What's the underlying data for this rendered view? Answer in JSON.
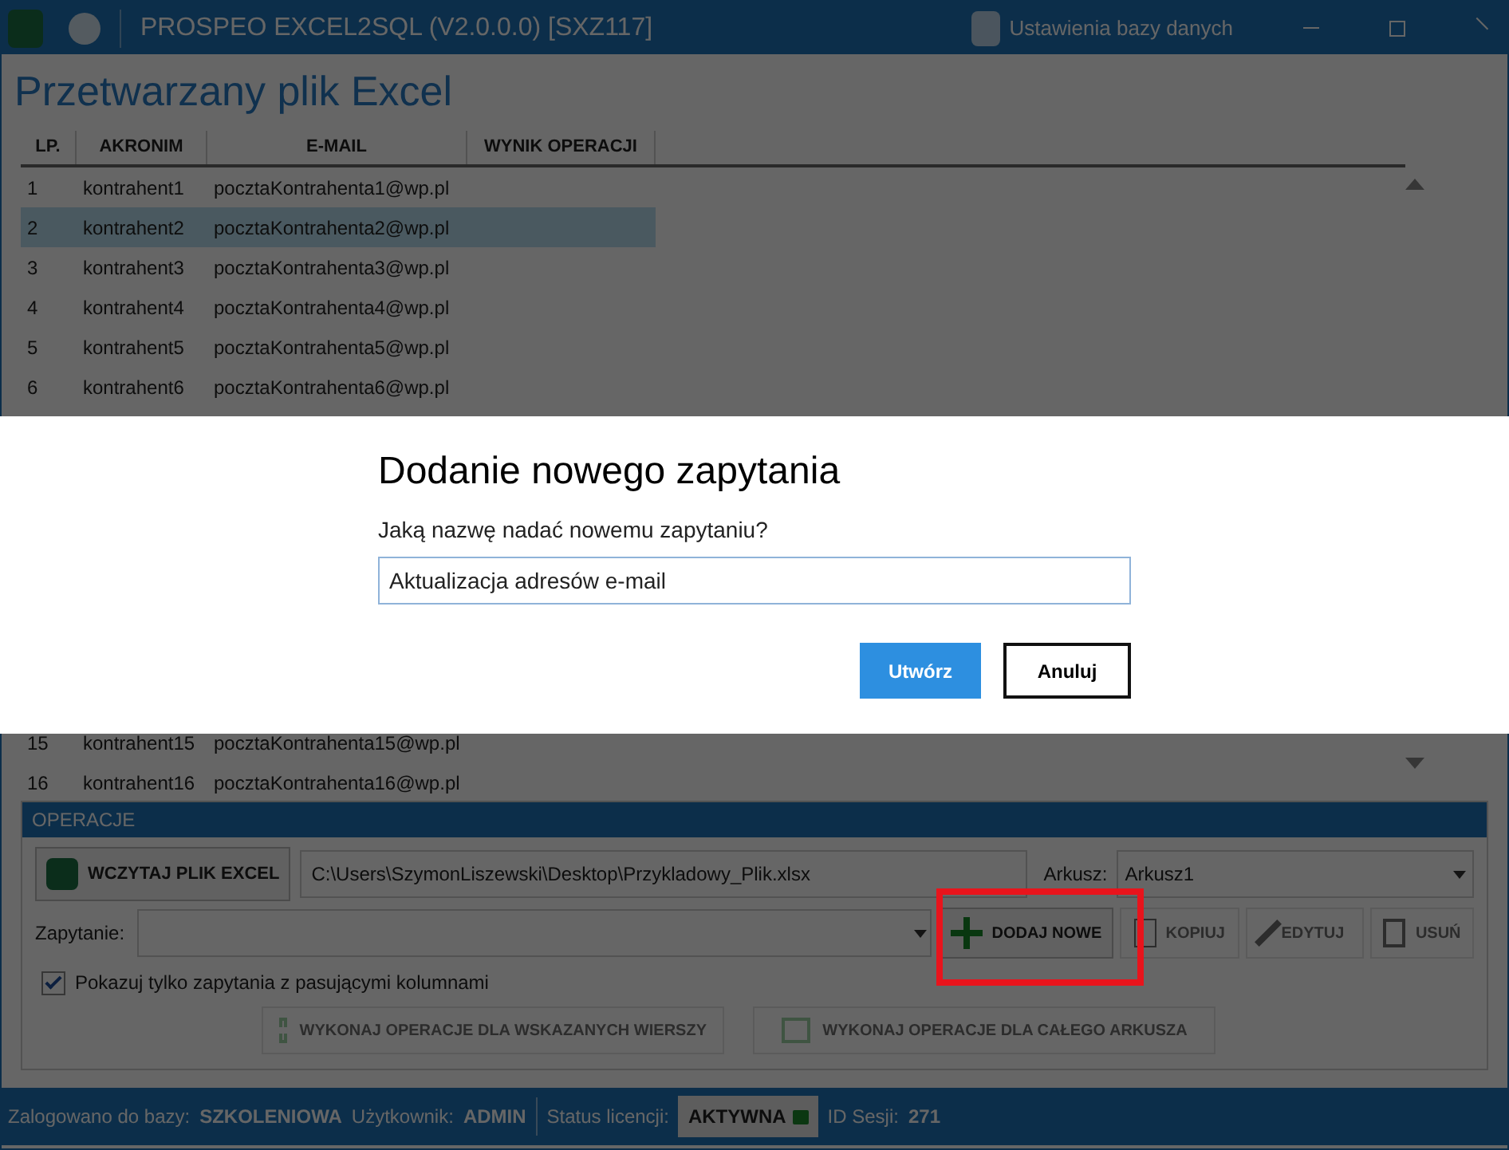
{
  "window": {
    "title": "PROSPEO EXCEL2SQL (V2.0.0.0) [SXZ117]",
    "db_settings": "Ustawienia bazy danych"
  },
  "heading": "Przetwarzany plik Excel",
  "table": {
    "columns": [
      "LP.",
      "AKRONIM",
      "E-MAIL",
      "WYNIK OPERACJI"
    ],
    "rows": [
      {
        "cells": [
          "1",
          "kontrahent1",
          "pocztaKontrahenta1@wp.pl",
          ""
        ],
        "selected": false
      },
      {
        "cells": [
          "2",
          "kontrahent2",
          "pocztaKontrahenta2@wp.pl",
          ""
        ],
        "selected": true
      },
      {
        "cells": [
          "3",
          "kontrahent3",
          "pocztaKontrahenta3@wp.pl",
          ""
        ],
        "selected": false
      },
      {
        "cells": [
          "4",
          "kontrahent4",
          "pocztaKontrahenta4@wp.pl",
          ""
        ],
        "selected": false
      },
      {
        "cells": [
          "5",
          "kontrahent5",
          "pocztaKontrahenta5@wp.pl",
          ""
        ],
        "selected": false
      },
      {
        "cells": [
          "6",
          "kontrahent6",
          "pocztaKontrahenta6@wp.pl",
          ""
        ],
        "selected": false
      }
    ],
    "rows_below_dialog": [
      {
        "cells": [
          "15",
          "kontrahent15",
          "pocztaKontrahenta15@wp.pl",
          ""
        ],
        "selected": false
      },
      {
        "cells": [
          "16",
          "kontrahent16",
          "pocztaKontrahenta16@wp.pl",
          ""
        ],
        "selected": false
      }
    ]
  },
  "operations": {
    "header": "OPERACJE",
    "load_button": "WCZYTAJ PLIK EXCEL",
    "file_path": "C:\\Users\\SzymonLiszewski\\Desktop\\Przykladowy_Plik.xlsx",
    "sheet_label": "Arkusz:",
    "sheet_value": "Arkusz1",
    "query_label": "Zapytanie:",
    "query_buttons": [
      {
        "label": "DODAJ NOWE",
        "kind": "add",
        "disabled": false
      },
      {
        "label": "KOPIUJ",
        "kind": "copy",
        "disabled": true
      },
      {
        "label": "EDYTUJ",
        "kind": "edit",
        "disabled": true
      },
      {
        "label": "USUŃ",
        "kind": "delete",
        "disabled": true
      }
    ],
    "filter_checkbox": {
      "label": "Pokazuj tylko zapytania z pasującymi kolumnami",
      "checked": true
    },
    "run_buttons": [
      {
        "label": "WYKONAJ OPERACJE DLA WSKAZANYCH WIERSZY",
        "kind": "rows",
        "disabled": true
      },
      {
        "label": "WYKONAJ OPERACJE DLA CAŁEGO ARKUSZA",
        "kind": "sheet",
        "disabled": true
      }
    ]
  },
  "status_bar": {
    "db_label": "Zalogowano do bazy:",
    "db_value": "SZKOLENIOWA",
    "user_label": "Użytkownik:",
    "user_value": "ADMIN",
    "license_label": "Status licencji:",
    "license_value": "AKTYWNA",
    "session_label": "ID Sesji:",
    "session_value": "271"
  },
  "dialog": {
    "title": "Dodanie nowego zapytania",
    "prompt": "Jaką nazwę nadać nowemu zapytaniu?",
    "input_value": "Aktualizacja adresów e-mail",
    "buttons": [
      {
        "label": "Utwórz",
        "kind": "primary"
      },
      {
        "label": "Anuluj",
        "kind": "secondary"
      }
    ]
  }
}
